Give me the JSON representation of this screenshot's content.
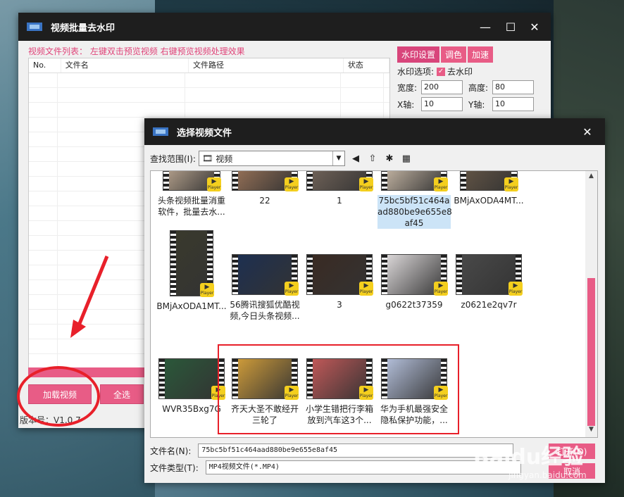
{
  "main": {
    "title": "视频批量去水印",
    "hint": "视频文件列表：  左键双击预览视频 右键预览视频处理效果",
    "columns": [
      "No.",
      "文件名",
      "文件路径",
      "状态"
    ],
    "load_button": "加载视频",
    "select_all_button": "全选",
    "version": "版本号：V1.0.7"
  },
  "side": {
    "tabs": [
      "水印设置",
      "调色",
      "加速"
    ],
    "option_label": "水印选项:",
    "remove_wm": "去水印",
    "width_label": "宽度:",
    "width": "200",
    "height_label": "高度:",
    "height": "80",
    "x_label": "X轴:",
    "x": "10",
    "y_label": "Y轴:",
    "y": "10"
  },
  "dialog": {
    "title": "选择视频文件",
    "look_in_label": "查找范围(I):",
    "look_in_value": "视频",
    "filename_label": "文件名(N):",
    "filename_value": "75bc5bf51c464aad880be9e655e8af45",
    "filetype_label": "文件类型(T):",
    "filetype_value": "MP4视频文件(*.MP4)",
    "open_button": "打开(O)",
    "cancel_button": "取消",
    "player_badge": "Player",
    "files": [
      {
        "label": "头条视频批量消重\n软件，批量去水..."
      },
      {
        "label": "22"
      },
      {
        "label": "1"
      },
      {
        "label": "75bc5bf51c464a\nad880be9e655e8\naf45"
      },
      {
        "label": "BMjAxODA4MT..."
      },
      {
        "label": "BMjAxODA1MT..."
      },
      {
        "label": "56腾讯搜狐优酷视\n频,今日头条视频..."
      },
      {
        "label": "3"
      },
      {
        "label": "g0622t37359"
      },
      {
        "label": "z0621e2qv7r"
      },
      {
        "label": "WVR35Bxg7G"
      },
      {
        "label": "齐天大圣不敢经开\n三轮了"
      },
      {
        "label": "小学生错把行李箱\n放到汽车这3个..."
      },
      {
        "label": "华为手机最强安全\n隐私保护功能，..."
      }
    ]
  },
  "watermark": {
    "brand": "Baidu经验",
    "url": "jingyan.baidu.com"
  },
  "colors": {
    "accent": "#e85c86",
    "titlebar": "#1e1e1e",
    "annotation": "#e8202a"
  }
}
